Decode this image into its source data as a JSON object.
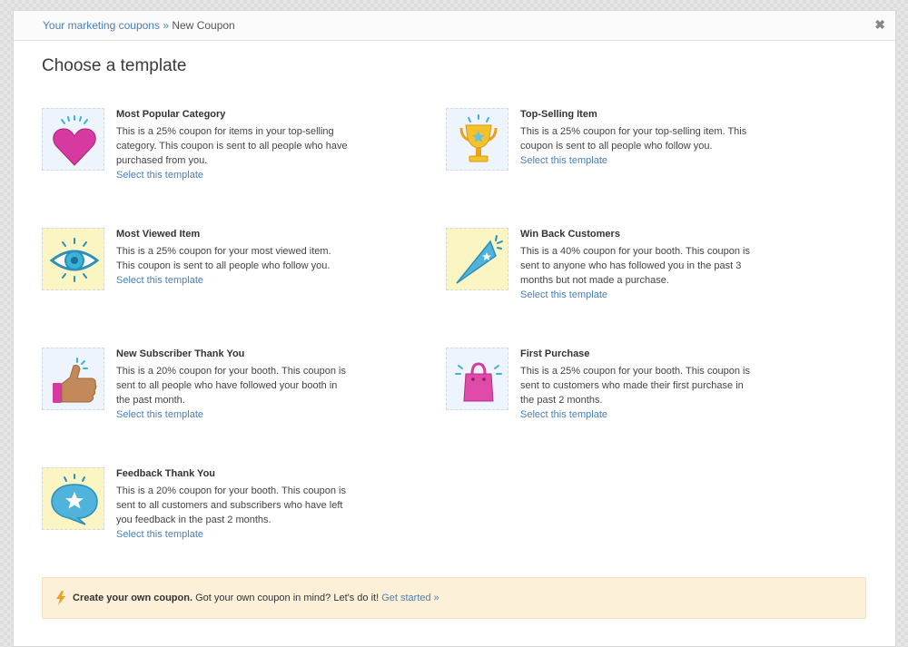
{
  "breadcrumb": {
    "parent": "Your marketing coupons",
    "separator": "»",
    "current": "New Coupon"
  },
  "close_label": "✖",
  "page_title": "Choose a template",
  "templates": [
    {
      "name": "Most Popular Category",
      "description": "This is a 25% coupon for items in your top-selling category. This coupon is sent to all people who have purchased from you.",
      "link": "Select this template",
      "icon": "heart-icon"
    },
    {
      "name": "Top-Selling Item",
      "description": "This is a 25% coupon for your top-selling item. This coupon is sent to all people who follow you.",
      "link": "Select this template",
      "icon": "trophy-icon"
    },
    {
      "name": "Most Viewed Item",
      "description": "This is a 25% coupon for your most viewed item. This coupon is sent to all people who follow you.",
      "link": "Select this template",
      "icon": "eye-icon"
    },
    {
      "name": "Win Back Customers",
      "description": "This is a 40% coupon for your booth. This coupon is sent to anyone who has followed you in the past 3 months but not made a purchase.",
      "link": "Select this template",
      "icon": "pennant-icon"
    },
    {
      "name": "New Subscriber Thank You",
      "description": "This is a 20% coupon for your booth. This coupon is sent to all people who have followed your booth in the past month.",
      "link": "Select this template",
      "icon": "thumbs-up-icon"
    },
    {
      "name": "First Purchase",
      "description": "This is a 25% coupon for your booth. This coupon is sent to customers who made their first purchase in the past 2 months.",
      "link": "Select this template",
      "icon": "shopping-bag-icon"
    },
    {
      "name": "Feedback Thank You",
      "description": "This is a 20% coupon for your booth. This coupon is sent to all customers and subscribers who have left you feedback in the past 2 months.",
      "link": "Select this template",
      "icon": "speech-bubble-star-icon"
    }
  ],
  "banner": {
    "title": "Create your own coupon.",
    "text": "Got your own coupon in mind? Let's do it!",
    "link": "Get started »",
    "icon": "lightning-bolt-icon"
  },
  "colors": {
    "link": "#4a7fb5",
    "banner_bg": "#fdf0d9",
    "thumb_blue": "#eef4fb",
    "thumb_yellow": "#fbf5c4"
  }
}
